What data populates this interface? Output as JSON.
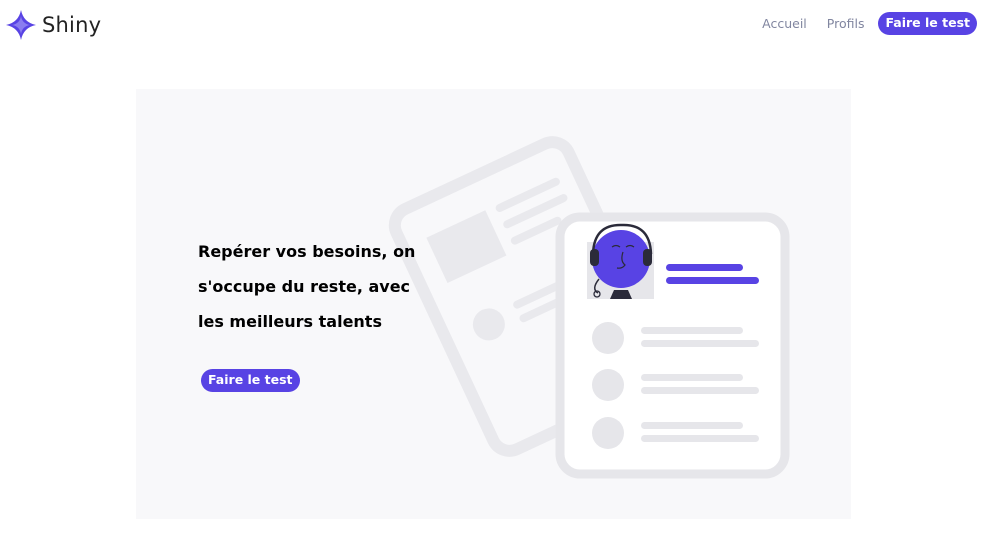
{
  "app": {
    "brand": "Shiny"
  },
  "nav": {
    "home": "Accueil",
    "profiles": "Profils",
    "cta": "Faire le test"
  },
  "hero": {
    "title": "Repérer vos besoins, on s'occupe du reste, avec les meilleurs talents",
    "cta": "Faire le test"
  },
  "colors": {
    "accent": "#5843e4",
    "hero_background": "#f8f8fa",
    "nav_text": "#8186a0"
  },
  "icons": {
    "logo": "four-point-star-icon",
    "illustration": "profile-cards-illustration"
  }
}
